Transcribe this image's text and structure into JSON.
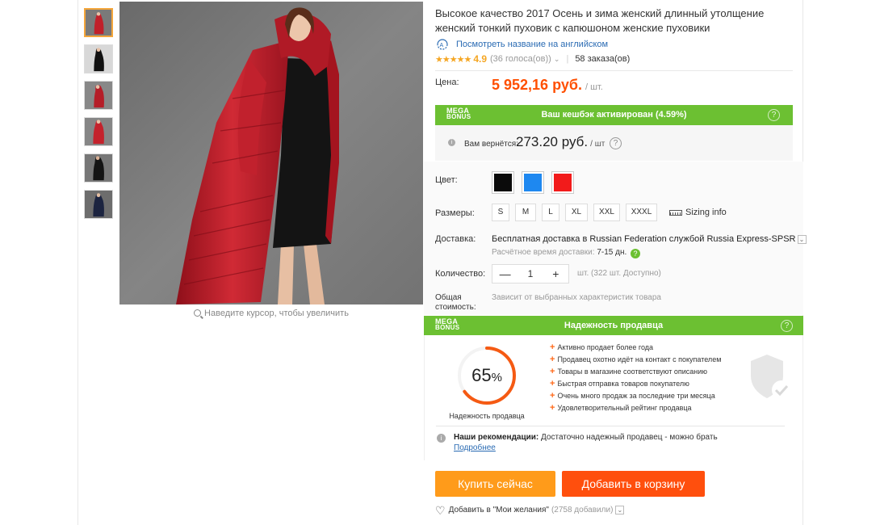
{
  "gallery": {
    "thumbnails": [
      {
        "alt": "red coat front"
      },
      {
        "alt": "black coat"
      },
      {
        "alt": "red coat side"
      },
      {
        "alt": "red coat full"
      },
      {
        "alt": "black coat back"
      },
      {
        "alt": "navy coat"
      }
    ],
    "zoom_hint": "Наведите курсор, чтобы увеличить"
  },
  "product": {
    "title": "Высокое качество 2017 Осень и зима женский длинный утолщение женский тонкий пуховик с капюшоном женские пуховики",
    "translate_link": "Посмотреть название на английском",
    "stars": "★★★★★",
    "rating": "4.9",
    "votes": "(36 голоса(ов))",
    "orders": "58 заказа(ов)"
  },
  "price": {
    "label": "Цена:",
    "value": "5 952,16 руб.",
    "unit": "/ шт."
  },
  "megabonus": {
    "logo_top": "MEGA",
    "logo_bottom": "BONUS",
    "cashback_text": "Ваш кешбэк активирован (4.59%)",
    "help": "?",
    "return_label": "Вам вернётся:",
    "return_value": "273.20 руб.",
    "return_unit": "/ шт"
  },
  "options": {
    "color_label": "Цвет:",
    "colors": [
      "#0b0b0b",
      "#1e88f0",
      "#f21b1b"
    ],
    "size_label": "Размеры:",
    "sizes": [
      "S",
      "M",
      "L",
      "XL",
      "XXL",
      "XXXL"
    ],
    "sizing_info": "Sizing info",
    "shipping_label": "Доставка:",
    "shipping_text": "Бесплатная доставка в Russian Federation службой Russia Express-SPSR",
    "shipping_time_label": "Расчётное время доставки:",
    "shipping_days": "7-15  дн.",
    "qty_label": "Количество:",
    "qty_minus": "—",
    "qty_value": "1",
    "qty_plus": "+",
    "qty_available": "шт. (322 шт. Доступно)",
    "total_label_1": "Общая",
    "total_label_2": "стоимость:",
    "total_value": "Зависит от выбранных характеристик товара"
  },
  "seller": {
    "header": "Надежность продавца",
    "score": "65",
    "score_unit": "%",
    "score_fraction": 0.65,
    "score_label": "Надежность продавца",
    "reasons": [
      "Активно продает более года",
      "Продавец охотно идёт на контакт с покупателем",
      "Товары в магазине соответствуют описанию",
      "Быстрая отправка товаров покупателю",
      "Очень много продаж за последние три месяца",
      "Удовлетворительный рейтинг продавца"
    ],
    "rec_title": "Наши рекомендации:",
    "rec_text": " Достаточно надежный продавец - можно брать ",
    "rec_link": "Подробнее"
  },
  "actions": {
    "buy_now": "Купить сейчас",
    "add_to_cart": "Добавить в корзину",
    "wishlist": "Добавить в \"Мои желания\"",
    "wishlist_count": "(2758 добавили)"
  },
  "colors": {
    "accent_orange": "#ff4f00",
    "mega_green": "#6cc032",
    "link_blue": "#2a6bb3"
  }
}
